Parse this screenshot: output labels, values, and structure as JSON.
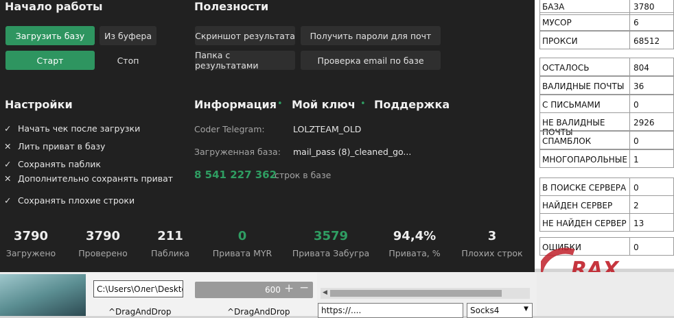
{
  "start": {
    "title": "Начало работы",
    "load_base": "Загрузить базу",
    "from_buffer": "Из буфера",
    "start": "Старт",
    "stop": "Стоп"
  },
  "useful": {
    "title": "Полезности",
    "screenshot": "Скриншот результата",
    "get_passwords": "Получить пароли для почт",
    "results_folder": "Папка с результатами",
    "check_email": "Проверка email по базе"
  },
  "settings": {
    "title": "Настройки",
    "items": [
      {
        "mark": "✓",
        "label": "Начать чек после загрузки"
      },
      {
        "mark": "✕",
        "label": "Лить приват в базу"
      },
      {
        "mark": "✓",
        "label": "Сохранять паблик"
      },
      {
        "mark": "✕",
        "label": "Дополнительно сохранять приват"
      },
      {
        "mark": "✓",
        "label": "Сохранять плохие строки"
      }
    ]
  },
  "info": {
    "tab_info": "Информация",
    "tab_key": "Мой ключ",
    "tab_support": "Поддержка",
    "dot": "•",
    "coder_label": "Coder Telegram:",
    "coder_value": "LOLZTEAM_OLD",
    "base_label": "Загруженная база:",
    "base_value": "mail_pass (8)_cleaned_go...",
    "lines_count": "8 541 227 362",
    "lines_label": "строк в базе",
    "accent_color": "#2f9d62"
  },
  "stats": [
    {
      "value": "3790",
      "label": "Загружено"
    },
    {
      "value": "3790",
      "label": "Проверено"
    },
    {
      "value": "211",
      "label": "Паблика"
    },
    {
      "value": "0",
      "label": "Привата MYR"
    },
    {
      "value": "3579",
      "label": "Привата Забугра"
    },
    {
      "value": "94,4%",
      "label": "Привата, %"
    },
    {
      "value": "3",
      "label": "Плохих строк"
    }
  ],
  "side_table": {
    "group1": [
      {
        "key": "БАЗА",
        "value": "3780"
      },
      {
        "key": "МУСОР",
        "value": "6"
      },
      {
        "key": "ПРОКСИ",
        "value": "68512"
      }
    ],
    "group2": [
      {
        "key": "ОСТАЛОСЬ",
        "value": "804"
      },
      {
        "key": "ВАЛИДНЫЕ ПОЧТЫ",
        "value": "36"
      },
      {
        "key": "С ПИСЬМАМИ",
        "value": "0"
      },
      {
        "key": "НЕ ВАЛИДНЫЕ ПОЧТЫ",
        "value": "2926"
      },
      {
        "key": "СПАМБЛОК",
        "value": "0"
      },
      {
        "key": "МНОГОПАРОЛЬНЫЕ",
        "value": "1"
      }
    ],
    "group3": [
      {
        "key": "В ПОИСКЕ СЕРВЕРА",
        "value": "0"
      },
      {
        "key": "НАЙДЕН СЕРВЕР",
        "value": "2"
      },
      {
        "key": "НЕ НАЙДЕН СЕРВЕР",
        "value": "13"
      }
    ],
    "group4": [
      {
        "key": "ОШИБКИ",
        "value": "0"
      }
    ]
  },
  "bottom": {
    "path_value": "C:\\Users\\Олег\\Desktop",
    "drag_drop_1": "^DragAndDrop",
    "threads_value": "600",
    "drag_drop_2": "^DragAndDrop",
    "url_value": "https://....",
    "proxy_type": "Socks4"
  },
  "watermark": "RAX"
}
